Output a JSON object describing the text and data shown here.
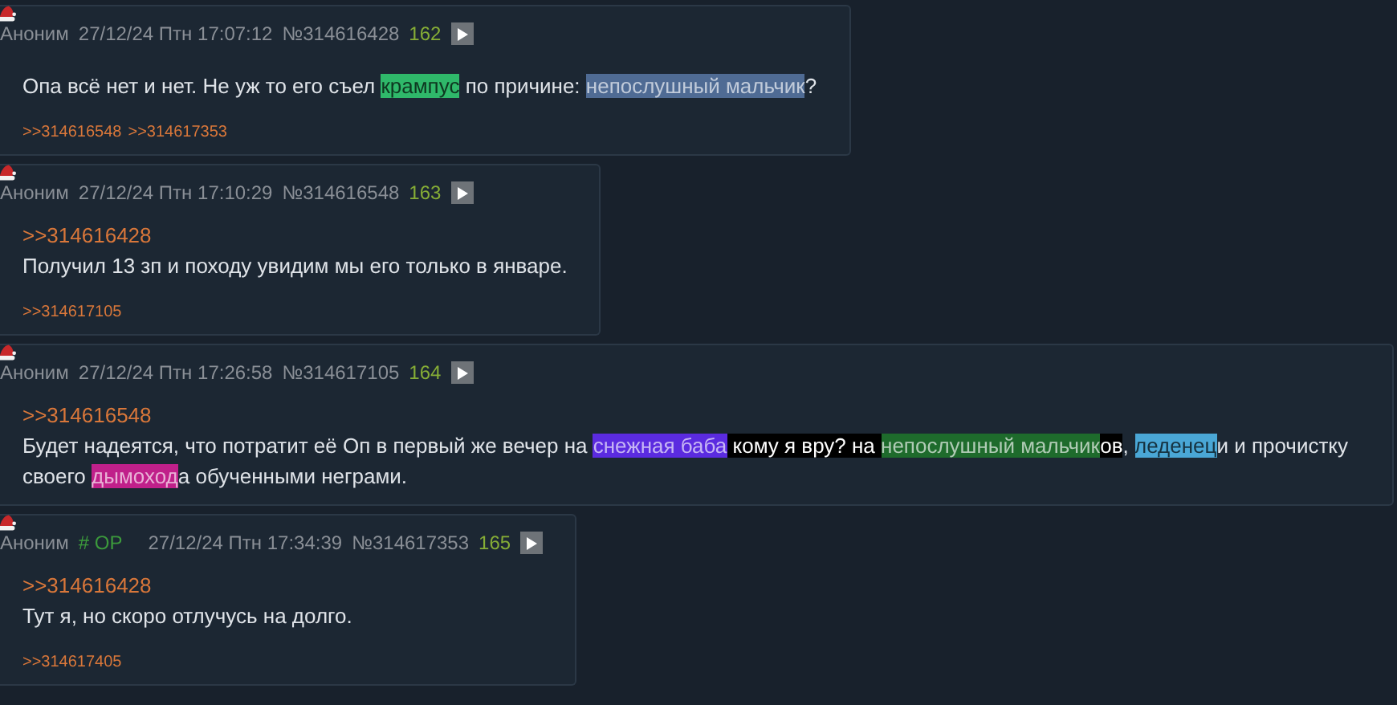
{
  "posts": [
    {
      "name": "Аноним",
      "date": "27/12/24 Птн 17:07:12",
      "number": "№314616428",
      "count": "162",
      "body": [
        {
          "kind": "plain",
          "text": "Опа всё нет и нет. Не уж то его съел "
        },
        {
          "kind": "spoiler",
          "text": "крампус",
          "color": "#2fb86a"
        },
        {
          "kind": "plain",
          "text": " по причине: "
        },
        {
          "kind": "spoiler",
          "text": "непослушный мальчик",
          "color": "#4f6b94"
        },
        {
          "kind": "plain",
          "text": "?"
        }
      ],
      "replies": [
        ">>314616548",
        ">>314617353"
      ]
    },
    {
      "name": "Аноним",
      "date": "27/12/24 Птн 17:10:29",
      "number": "№314616548",
      "count": "163",
      "quote": ">>314616428",
      "body": [
        {
          "kind": "plain",
          "text": "Получил 13 зп и походу увидим мы его только в январе."
        }
      ],
      "replies": [
        ">>314617105"
      ]
    },
    {
      "name": "Аноним",
      "date": "27/12/24 Птн 17:26:58",
      "number": "№314617105",
      "count": "164",
      "quote": ">>314616548",
      "body": [
        {
          "kind": "plain",
          "text": "Будет надеятся, что потратит её Оп в первый же вечер на "
        },
        {
          "kind": "spoiler",
          "text": "снежная баба",
          "color": "#5b2be0"
        },
        {
          "kind": "highlight",
          "text": " кому я вру? на ",
          "color": "#000000"
        },
        {
          "kind": "spoiler",
          "text": "непослушный мальчик",
          "color": "#1e6b2c"
        },
        {
          "kind": "highlight",
          "text": "ов",
          "color": "#000000"
        },
        {
          "kind": "plain",
          "text": ", "
        },
        {
          "kind": "spoiler",
          "text": "леденец",
          "color": "#4aa7d6"
        },
        {
          "kind": "plain",
          "text": "и и прочистку своего "
        },
        {
          "kind": "spoiler",
          "text": "дымоход",
          "color": "#c0208a"
        },
        {
          "kind": "plain",
          "text": "а обученными неграми."
        }
      ]
    },
    {
      "name": "Аноним",
      "op_tag": "# OP",
      "date": "27/12/24 Птн 17:34:39",
      "number": "№314617353",
      "count": "165",
      "quote": ">>314616428",
      "body": [
        {
          "kind": "plain",
          "text": "Тут я, но скоро отлучусь на долго."
        }
      ],
      "replies": [
        ">>314617405"
      ]
    }
  ]
}
